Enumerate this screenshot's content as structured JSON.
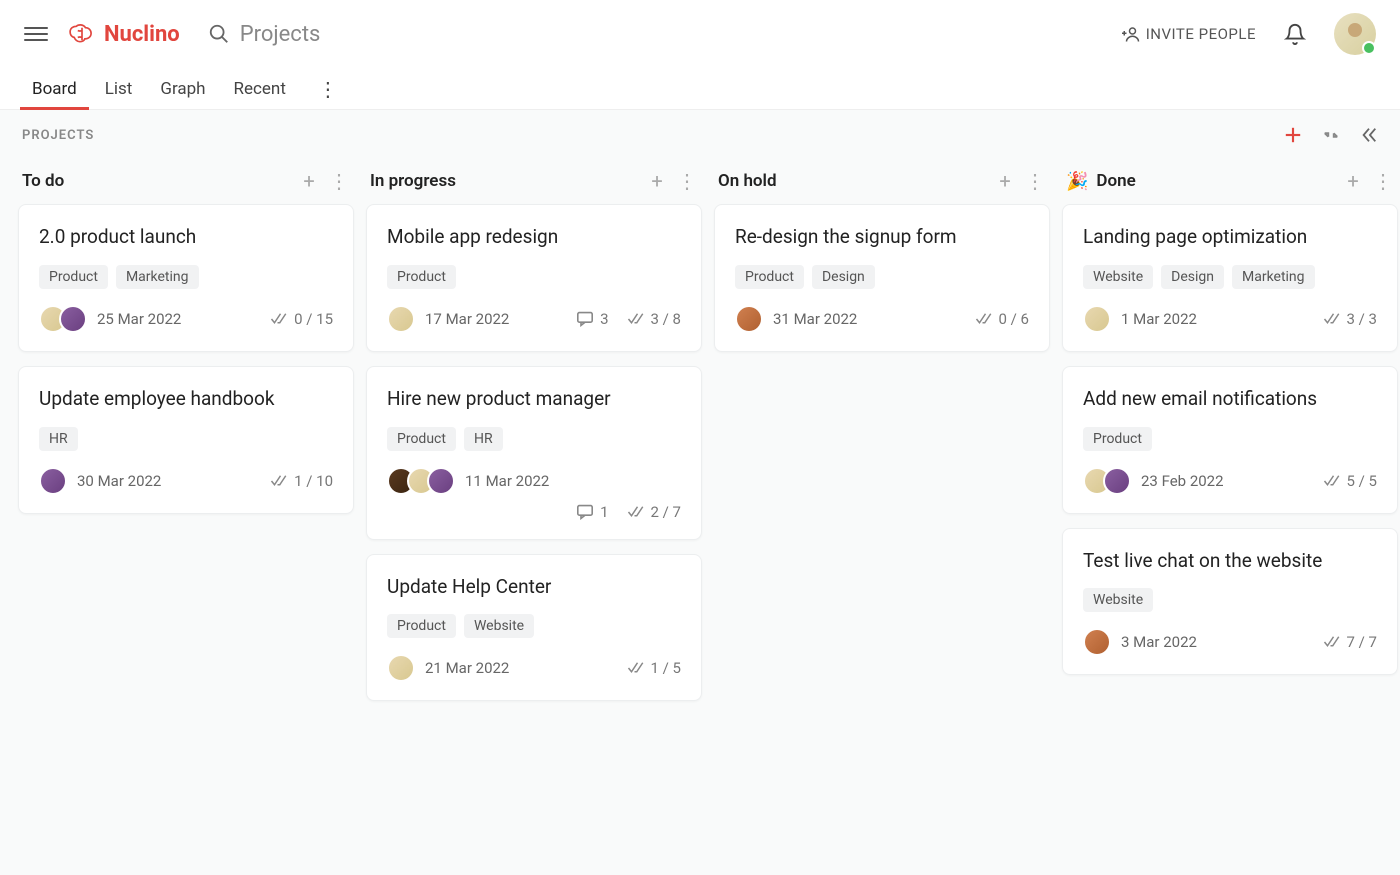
{
  "header": {
    "logo_text": "Nuclino",
    "search_placeholder": "Projects",
    "invite_label": "INVITE PEOPLE"
  },
  "views": {
    "tabs": [
      "Board",
      "List",
      "Graph",
      "Recent"
    ],
    "active": "Board"
  },
  "board": {
    "crumb": "PROJECTS",
    "columns": [
      {
        "title": "To do",
        "emoji": "",
        "cards": [
          {
            "title": "2.0 product launch",
            "tags": [
              "Product",
              "Marketing"
            ],
            "avatars": [
              "av0",
              "av1"
            ],
            "date": "25 Mar 2022",
            "comments": null,
            "checklist": "0 / 15"
          },
          {
            "title": "Update employee handbook",
            "tags": [
              "HR"
            ],
            "avatars": [
              "av1"
            ],
            "date": "30 Mar 2022",
            "comments": null,
            "checklist": "1 / 10"
          }
        ]
      },
      {
        "title": "In progress",
        "emoji": "",
        "cards": [
          {
            "title": "Mobile app redesign",
            "tags": [
              "Product"
            ],
            "avatars": [
              "av0"
            ],
            "date": "17 Mar 2022",
            "comments": "3",
            "checklist": "3 / 8"
          },
          {
            "title": "Hire new product manager",
            "tags": [
              "Product",
              "HR"
            ],
            "avatars": [
              "av3",
              "av0",
              "av1"
            ],
            "date": "11 Mar 2022",
            "comments": "1",
            "checklist": "2 / 7",
            "wrap_stats": true
          },
          {
            "title": "Update Help Center",
            "tags": [
              "Product",
              "Website"
            ],
            "avatars": [
              "av0"
            ],
            "date": "21 Mar 2022",
            "comments": null,
            "checklist": "1 / 5"
          }
        ]
      },
      {
        "title": "On hold",
        "emoji": "",
        "cards": [
          {
            "title": "Re-design the signup form",
            "tags": [
              "Product",
              "Design"
            ],
            "avatars": [
              "av2"
            ],
            "date": "31 Mar 2022",
            "comments": null,
            "checklist": "0 / 6"
          }
        ]
      },
      {
        "title": "Done",
        "emoji": "🎉",
        "cards": [
          {
            "title": "Landing page optimization",
            "tags": [
              "Website",
              "Design",
              "Marketing"
            ],
            "avatars": [
              "av0"
            ],
            "date": "1 Mar 2022",
            "comments": null,
            "checklist": "3 / 3"
          },
          {
            "title": "Add new email notifications",
            "tags": [
              "Product"
            ],
            "avatars": [
              "av0",
              "av1"
            ],
            "date": "23 Feb 2022",
            "comments": null,
            "checklist": "5 / 5"
          },
          {
            "title": "Test live chat on the website",
            "tags": [
              "Website"
            ],
            "avatars": [
              "av2"
            ],
            "date": "3 Mar 2022",
            "comments": null,
            "checklist": "7 / 7"
          }
        ]
      }
    ]
  }
}
